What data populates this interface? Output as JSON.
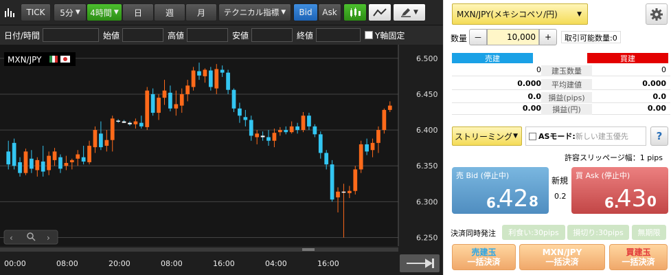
{
  "toolbar": {
    "tick": "TICK",
    "interval": "5分",
    "interval_active": "4時間",
    "day": "日",
    "week": "週",
    "month": "月",
    "technical": "テクニカル指標",
    "bid": "Bid",
    "ask": "Ask"
  },
  "ohlc": {
    "datetime": "日付/時間",
    "open": "始値",
    "high": "高値",
    "low": "安値",
    "close": "終値",
    "y_fix": "Y軸固定"
  },
  "chart_data": {
    "type": "candlestick",
    "symbol": "MXN/JPY",
    "yticks": [
      "6.500",
      "6.450",
      "6.400",
      "6.350",
      "6.300",
      "6.250"
    ],
    "ylim": [
      6.238,
      6.519
    ],
    "xticks": [
      "00:00",
      "08:00",
      "20:00",
      "08:00",
      "16:00",
      "04:00",
      "16:00"
    ],
    "up_color": "#ff6a1a",
    "down_color": "#33c6f2",
    "candles": [
      [
        6.37,
        6.385,
        6.345,
        6.352
      ],
      [
        6.382,
        6.388,
        6.345,
        6.35
      ],
      [
        6.355,
        6.362,
        6.335,
        6.34
      ],
      [
        6.34,
        6.374,
        6.337,
        6.37
      ],
      [
        6.36,
        6.372,
        6.34,
        6.346
      ],
      [
        6.344,
        6.362,
        6.335,
        6.358
      ],
      [
        6.356,
        6.378,
        6.335,
        6.342
      ],
      [
        6.344,
        6.37,
        6.337,
        6.364
      ],
      [
        6.358,
        6.375,
        6.35,
        6.37
      ],
      [
        6.362,
        6.366,
        6.34,
        6.346
      ],
      [
        6.35,
        6.364,
        6.344,
        6.354
      ],
      [
        6.355,
        6.36,
        6.345,
        6.358
      ],
      [
        6.36,
        6.372,
        6.35,
        6.366
      ],
      [
        6.362,
        6.378,
        6.352,
        6.356
      ],
      [
        6.355,
        6.385,
        6.352,
        6.378
      ],
      [
        6.376,
        6.405,
        6.368,
        6.4
      ],
      [
        6.395,
        6.412,
        6.372,
        6.376
      ],
      [
        6.378,
        6.4,
        6.37,
        6.386
      ],
      [
        6.386,
        6.42,
        6.37,
        6.416
      ],
      [
        6.413,
        6.415,
        6.41,
        6.412
      ],
      [
        6.412,
        6.414,
        6.41,
        6.41
      ],
      [
        6.41,
        6.412,
        6.406,
        6.408
      ],
      [
        6.408,
        6.416,
        6.402,
        6.412
      ],
      [
        6.41,
        6.42,
        6.402,
        6.405
      ],
      [
        6.404,
        6.46,
        6.4,
        6.455
      ],
      [
        6.45,
        6.458,
        6.42,
        6.424
      ],
      [
        6.424,
        6.45,
        6.414,
        6.445
      ],
      [
        6.445,
        6.47,
        6.435,
        6.455
      ],
      [
        6.452,
        6.462,
        6.426,
        6.43
      ],
      [
        6.43,
        6.455,
        6.42,
        6.436
      ],
      [
        6.434,
        6.458,
        6.424,
        6.45
      ],
      [
        6.45,
        6.47,
        6.44,
        6.462
      ],
      [
        6.46,
        6.488,
        6.455,
        6.483
      ],
      [
        6.482,
        6.494,
        6.47,
        6.476
      ],
      [
        6.475,
        6.486,
        6.466,
        6.484
      ],
      [
        6.483,
        6.488,
        6.455,
        6.46
      ],
      [
        6.458,
        6.492,
        6.45,
        6.485
      ],
      [
        6.484,
        6.49,
        6.474,
        6.48
      ],
      [
        6.48,
        6.484,
        6.45,
        6.456
      ],
      [
        6.456,
        6.458,
        6.425,
        6.43
      ],
      [
        6.43,
        6.438,
        6.41,
        6.42
      ],
      [
        6.418,
        6.428,
        6.405,
        6.414
      ],
      [
        6.414,
        6.42,
        6.385,
        6.392
      ],
      [
        6.39,
        6.4,
        6.38,
        6.395
      ],
      [
        6.392,
        6.398,
        6.385,
        6.39
      ],
      [
        6.39,
        6.4,
        6.378,
        6.385
      ],
      [
        6.385,
        6.402,
        6.376,
        6.396
      ],
      [
        6.397,
        6.404,
        6.392,
        6.4
      ],
      [
        6.4,
        6.405,
        6.394,
        6.397
      ],
      [
        6.397,
        6.412,
        6.395,
        6.405
      ],
      [
        6.405,
        6.41,
        6.395,
        6.4
      ],
      [
        6.4,
        6.425,
        6.397,
        6.42
      ],
      [
        6.42,
        6.424,
        6.4,
        6.405
      ],
      [
        6.405,
        6.408,
        6.39,
        6.394
      ],
      [
        6.394,
        6.398,
        6.36,
        6.368
      ],
      [
        6.368,
        6.372,
        6.345,
        6.352
      ],
      [
        6.352,
        6.358,
        6.3,
        6.303
      ],
      [
        6.306,
        6.32,
        6.285,
        6.314
      ],
      [
        6.314,
        6.325,
        6.25,
        6.314
      ],
      [
        6.312,
        6.322,
        6.305,
        6.315
      ],
      [
        6.315,
        6.35,
        6.31,
        6.345
      ],
      [
        6.345,
        6.385,
        6.34,
        6.38
      ],
      [
        6.38,
        6.388,
        6.365,
        6.37
      ],
      [
        6.372,
        6.388,
        6.362,
        6.382
      ],
      [
        6.382,
        6.405,
        6.368,
        6.4
      ],
      [
        6.4,
        6.43,
        6.395,
        6.428
      ],
      [
        6.428,
        6.44,
        6.425,
        6.434
      ]
    ]
  },
  "panel": {
    "symbol_select": "MXN/JPY(メキシコペソ/円)",
    "qty_label": "数量",
    "qty_minus": "－",
    "qty_value": "10,000",
    "qty_plus": "+",
    "available": "取引可能数量:",
    "available_value": "0",
    "sell_header": "売建",
    "buy_header": "買建",
    "rows": [
      {
        "label": "建玉数量",
        "sell": "0",
        "buy": "0"
      },
      {
        "label": "平均建値",
        "sell": "0.000",
        "buy": "0.000"
      },
      {
        "label": "損益(pips)",
        "sell": "0.0",
        "buy": "0.0"
      },
      {
        "label": "損益(円)",
        "sell": "0.00",
        "buy": "0.00"
      }
    ],
    "streaming": "ストリーミング",
    "as_mode": "ASモード:",
    "as_mode_value": "新しい建玉優先",
    "help": "?",
    "slippage": "許容スリッページ幅：1 pips",
    "sell_bid": "売 Bid (停止中)",
    "sell_price_prefix": "6.",
    "sell_price_main": "42",
    "sell_price_pip": "8",
    "new_label": "新規",
    "spread": "0.2",
    "buy_ask": "買 Ask (停止中)",
    "buy_price_prefix": "6.",
    "buy_price_main": "43",
    "buy_price_pip": "0",
    "settle_label": "決済同時発注",
    "take_profit": "利食い:30pips",
    "stop_loss": "損切り:30pips",
    "no_limit": "無期限",
    "btn_sell_close_1": "売建玉",
    "btn_sell_close_2": "一括決済",
    "btn_symbol_close_1": "MXN/JPY",
    "btn_symbol_close_2": "一括決済",
    "btn_buy_close_1": "買建玉",
    "btn_buy_close_2": "一括決済"
  }
}
